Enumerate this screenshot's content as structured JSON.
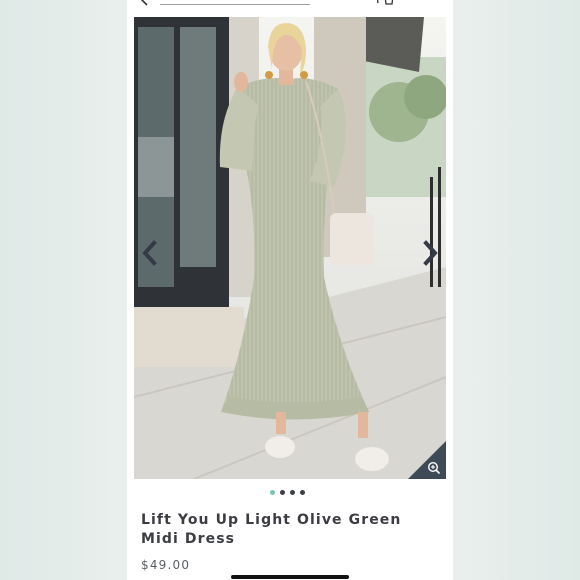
{
  "product": {
    "title": "Lift You Up Light Olive Green Midi Dress",
    "price": "$49.00",
    "image_alt": "Model wearing light olive green midi dress"
  },
  "carousel": {
    "total_images": 4,
    "active_index": 0
  },
  "icons": {
    "back": "chevron-left-icon",
    "cart": "cart-icon",
    "menu": "menu-icon",
    "prev": "chevron-left-icon",
    "next": "chevron-right-icon",
    "zoom": "zoom-in-icon"
  },
  "colors": {
    "background": "#e8efed",
    "accent_dot": "#79c5b6",
    "text": "#3b3d42",
    "zoom_corner": "#3f4a57"
  }
}
